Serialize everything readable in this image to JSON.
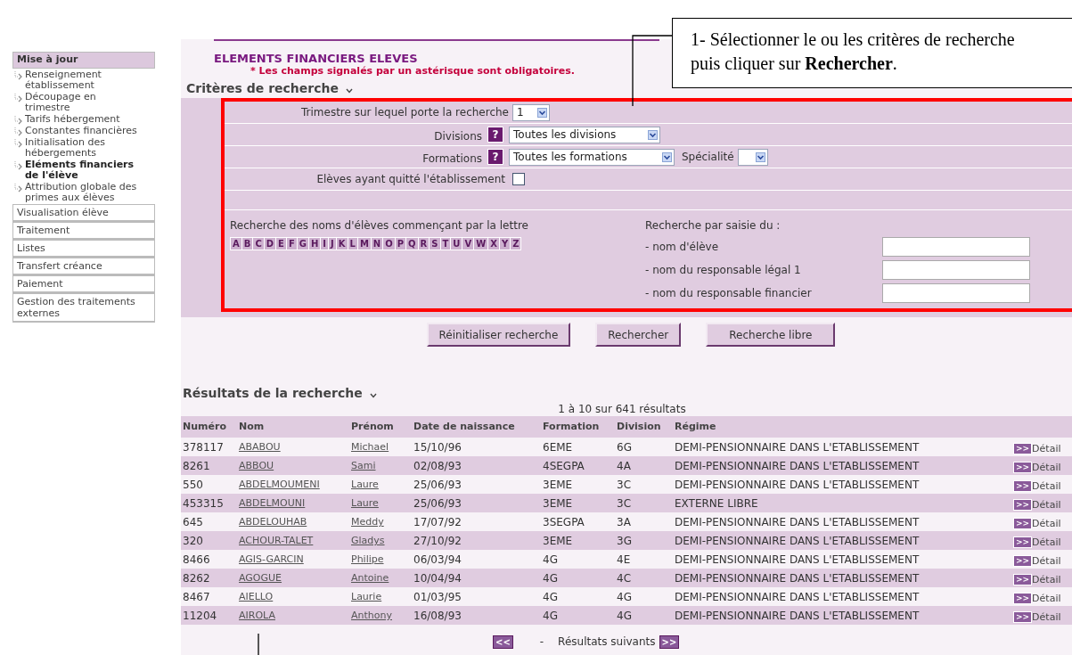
{
  "sidebar": {
    "heading": "Mise à jour",
    "links": [
      {
        "label": "Renseignement établissement",
        "selected": false
      },
      {
        "label": "Découpage en trimestre",
        "selected": false
      },
      {
        "label": "Tarifs hébergement",
        "selected": false
      },
      {
        "label": "Constantes financières",
        "selected": false
      },
      {
        "label": "Initialisation des hébergements",
        "selected": false
      },
      {
        "label": "Eléments financiers de l'élève",
        "selected": true
      },
      {
        "label": "Attribution globale des primes aux élèves",
        "selected": false
      }
    ],
    "sections": [
      "Visualisation élève",
      "Traitement",
      "Listes",
      "Transfert créance",
      "Paiement",
      "Gestion des traitements externes"
    ]
  },
  "page_title": "ELEMENTS FINANCIERS ELEVES",
  "required_note": "* Les champs signalés par un astérisque sont obligatoires.",
  "criteria": {
    "heading": "Critères de recherche",
    "trimestre": {
      "label": "Trimestre sur lequel porte la recherche",
      "value": "1"
    },
    "divisions": {
      "label": "Divisions",
      "help": "?",
      "value": "Toutes les divisions"
    },
    "formations": {
      "label": "Formations",
      "help": "?",
      "value": "Toutes les formations",
      "specialite_label": "Spécialité"
    },
    "left_school": {
      "label": "Elèves ayant quitté l'établissement",
      "checked": false
    },
    "letters_label": "Recherche des noms d'élèves commençant par la lettre",
    "letters": [
      "A",
      "B",
      "C",
      "D",
      "E",
      "F",
      "G",
      "H",
      "I",
      "J",
      "K",
      "L",
      "M",
      "N",
      "O",
      "P",
      "Q",
      "R",
      "S",
      "T",
      "U",
      "V",
      "W",
      "X",
      "Y",
      "Z"
    ],
    "text_search": {
      "heading": "Recherche par saisie du :",
      "fields": [
        "- nom d'élève",
        "- nom du responsable légal 1",
        "- nom du responsable financier"
      ]
    }
  },
  "buttons": [
    "Réinitialiser recherche",
    "Rechercher",
    "Recherche libre"
  ],
  "results": {
    "heading": "Résultats de la recherche",
    "count": "1 à 10 sur 641 résultats",
    "columns": [
      "Numéro",
      "Nom",
      "Prénom",
      "Date de naissance",
      "Formation",
      "Division",
      "Régime"
    ],
    "rows": [
      {
        "cells": [
          "378117",
          "ABABOU",
          "Michael",
          "15/10/96",
          "6EME",
          "6G",
          "DEMI-PENSIONNAIRE DANS L'ETABLISSEMENT"
        ],
        "detail_icon": ">>",
        "detail": "Détail"
      },
      {
        "cells": [
          "8261",
          "ABBOU",
          "Sami",
          "02/08/93",
          "4SEGPA",
          "4A",
          "DEMI-PENSIONNAIRE DANS L'ETABLISSEMENT"
        ],
        "detail_icon": ">>",
        "detail": "Détail"
      },
      {
        "cells": [
          "550",
          "ABDELMOUMENI",
          "Laure",
          "25/06/93",
          "3EME",
          "3C",
          "DEMI-PENSIONNAIRE DANS L'ETABLISSEMENT"
        ],
        "detail_icon": ">>",
        "detail": "Détail"
      },
      {
        "cells": [
          "453315",
          "ABDELMOUNI",
          "Laure",
          "25/06/93",
          "3EME",
          "3C",
          "EXTERNE LIBRE"
        ],
        "detail_icon": ">>",
        "detail": "Détail"
      },
      {
        "cells": [
          "645",
          "ABDELOUHAB",
          "Meddy",
          "17/07/92",
          "3SEGPA",
          "3A",
          "DEMI-PENSIONNAIRE DANS L'ETABLISSEMENT"
        ],
        "detail_icon": ">>",
        "detail": "Détail"
      },
      {
        "cells": [
          "320",
          "ACHOUR-TALET",
          "Gladys",
          "27/10/92",
          "3EME",
          "3G",
          "DEMI-PENSIONNAIRE DANS L'ETABLISSEMENT"
        ],
        "detail_icon": ">>",
        "detail": "Détail"
      },
      {
        "cells": [
          "8466",
          "AGIS-GARCIN",
          "Philipe",
          "06/03/94",
          "4G",
          "4E",
          "DEMI-PENSIONNAIRE DANS L'ETABLISSEMENT"
        ],
        "detail_icon": ">>",
        "detail": "Détail"
      },
      {
        "cells": [
          "8262",
          "AGOGUE",
          "Antoine",
          "10/04/94",
          "4G",
          "4C",
          "DEMI-PENSIONNAIRE DANS L'ETABLISSEMENT"
        ],
        "detail_icon": ">>",
        "detail": "Détail"
      },
      {
        "cells": [
          "8467",
          "AIELLO",
          "Laurie",
          "01/03/95",
          "4G",
          "4G",
          "DEMI-PENSIONNAIRE DANS L'ETABLISSEMENT"
        ],
        "detail_icon": ">>",
        "detail": "Détail"
      },
      {
        "cells": [
          "11204",
          "AIROLA",
          "Anthony",
          "16/08/93",
          "4G",
          "4G",
          "DEMI-PENSIONNAIRE DANS L'ETABLISSEMENT"
        ],
        "detail_icon": ">>",
        "detail": "Détail"
      }
    ]
  },
  "pagination": {
    "prev": "<<",
    "separator": "-",
    "next_label": "Résultats suivants",
    "next": ">>"
  },
  "callout": {
    "text": "1- Sélectionner le ou les critères de recherche puis cliquer sur **Rechercher**."
  }
}
